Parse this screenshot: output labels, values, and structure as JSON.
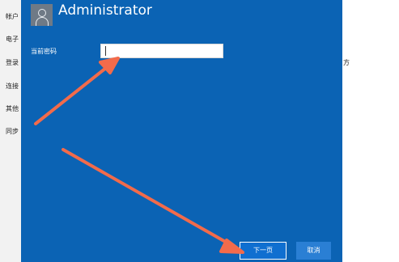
{
  "background": {
    "left_items": [
      "帐户",
      "电子",
      "登录",
      "连接",
      "其他",
      "同步"
    ],
    "right_text": "方"
  },
  "dialog": {
    "username": "Administrator",
    "avatar_icon": "user-icon",
    "password_label": "当前密码",
    "password_value": "",
    "next_label": "下一页",
    "cancel_label": "取消"
  },
  "annotations": {
    "arrow_color": "#f26b4b"
  }
}
